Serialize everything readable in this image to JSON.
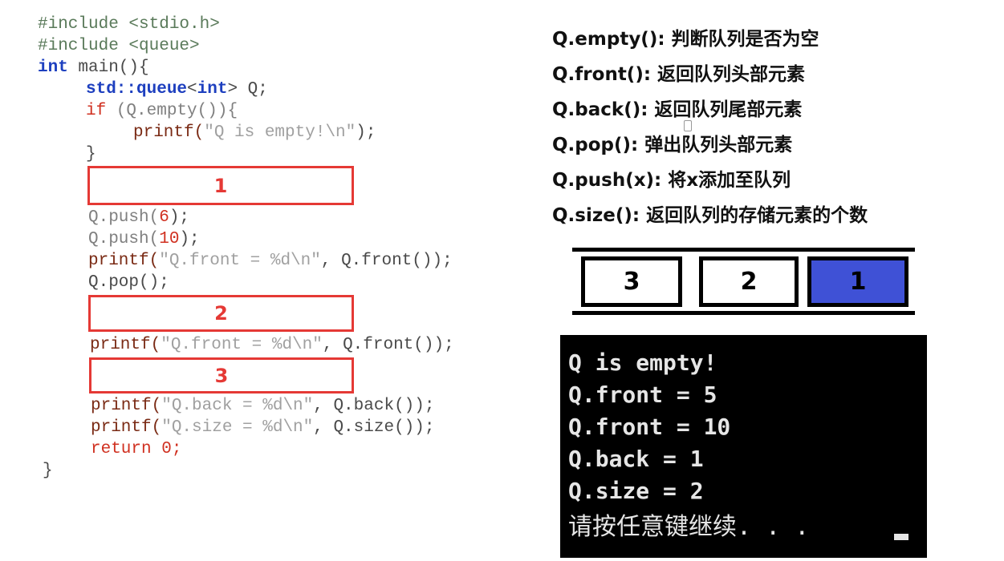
{
  "code": {
    "line1": "#include <stdio.h>",
    "line2": "#include <queue>",
    "line3_kw": "int",
    "line3_rest": " main(){",
    "line4_ns": "std::",
    "line4_queue": "queue",
    "line4_lt": "<",
    "line4_int": "int",
    "line4_rest": "> Q;",
    "line5_if": "if",
    "line5_rest": " (Q.empty()){",
    "line6_fn": "printf(",
    "line6_str": "\"Q is empty!\\n\"",
    "line6_end": ");",
    "line7": "}",
    "line8_a": "Q.push(",
    "line8_n": "6",
    "line8_b": ");",
    "line9_a": "Q.push(",
    "line9_n": "10",
    "line9_b": ");",
    "line10_fn": "printf(",
    "line10_str": "\"Q.front = %d\\n\"",
    "line10_rest": ", Q.front());",
    "line11": "Q.pop();",
    "line12_fn": "printf(",
    "line12_str": "\"Q.front = %d\\n\"",
    "line12_rest": ", Q.front());",
    "line13_fn": "printf(",
    "line13_str": "\"Q.back = %d\\n\"",
    "line13_rest": ", Q.back());",
    "line14_fn": "printf(",
    "line14_str": "\"Q.size = %d\\n\"",
    "line14_rest": ", Q.size());",
    "line15_kw": "return",
    "line15_rest": " 0;",
    "line16": "}"
  },
  "boxes": [
    "1",
    "2",
    "3"
  ],
  "api_list": [
    "Q.empty(): 判断队列是否为空",
    "Q.front(): 返回队列头部元素",
    "Q.back(): 返回队列尾部元素",
    "Q.pop(): 弹出队列头部元素",
    "Q.push(x): 将x添加至队列",
    "Q.size(): 返回队列的存储元素的个数"
  ],
  "queue_cells": [
    "3",
    "2",
    "1"
  ],
  "colors": {
    "highlight_cell": "#3f51d6",
    "box_red": "#e53935"
  },
  "console": [
    "Q is empty!",
    "Q.front = 5",
    "Q.front = 10",
    "Q.back = 1",
    "Q.size = 2",
    "请按任意键继续. . ."
  ]
}
